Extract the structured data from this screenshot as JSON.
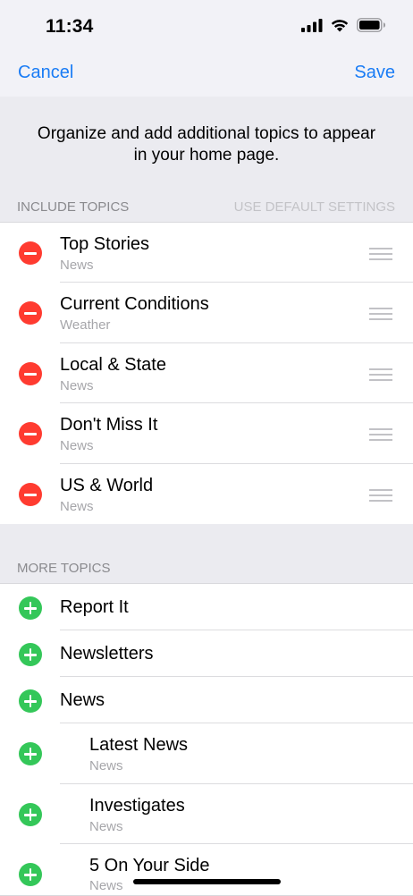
{
  "status": {
    "time": "11:34",
    "icons": [
      "cellular-signal-icon",
      "wifi-icon",
      "battery-icon"
    ]
  },
  "nav": {
    "cancel_label": "Cancel",
    "save_label": "Save"
  },
  "intro": {
    "line1": "Organize and add additional topics to appear",
    "line2": "in your home page."
  },
  "include_section": {
    "header": "INCLUDE TOPICS",
    "default_link": "USE DEFAULT SETTINGS",
    "items": [
      {
        "title": "Top Stories",
        "subtitle": "News"
      },
      {
        "title": "Current Conditions",
        "subtitle": "Weather"
      },
      {
        "title": "Local & State",
        "subtitle": "News"
      },
      {
        "title": "Don't Miss It",
        "subtitle": "News"
      },
      {
        "title": "US & World",
        "subtitle": "News"
      }
    ]
  },
  "more_section": {
    "header": "MORE TOPICS",
    "items": [
      {
        "title": "Report It"
      },
      {
        "title": "Newsletters"
      },
      {
        "title": "News"
      },
      {
        "title": "Latest News",
        "subtitle": "News"
      },
      {
        "title": "Investigates",
        "subtitle": "News"
      },
      {
        "title": "5 On Your Side",
        "subtitle": "News"
      }
    ]
  },
  "colors": {
    "accent": "#1a7cf5",
    "remove": "#ff3b30",
    "add": "#34c759",
    "background": "#f2f2f7"
  }
}
